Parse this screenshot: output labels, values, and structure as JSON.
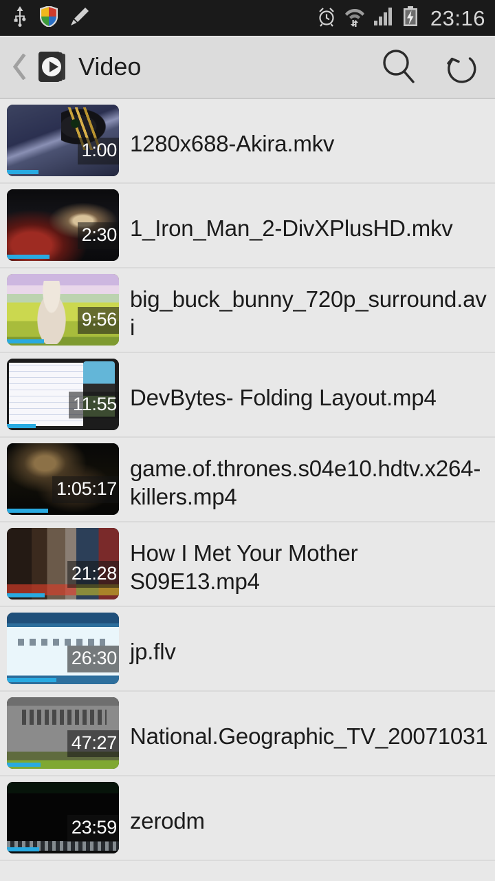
{
  "statusbar": {
    "time": "23:16",
    "left_icons": [
      {
        "name": "usb-icon"
      },
      {
        "name": "security-shield-icon"
      },
      {
        "name": "pencil-edit-icon"
      }
    ],
    "right_icons": [
      {
        "name": "alarm-clock-icon"
      },
      {
        "name": "wifi-transfer-icon"
      },
      {
        "name": "cellular-signal-icon"
      },
      {
        "name": "battery-charging-icon"
      }
    ]
  },
  "actionbar": {
    "back_label": "‹",
    "app_icon_name": "video-app-icon",
    "title": "Video",
    "search_label": "search-icon",
    "refresh_label": "refresh-icon"
  },
  "colors": {
    "accent_progress": "#29aae1",
    "background": "#e8e8e8",
    "actionbar_bg": "#dcdcdc",
    "statusbar_bg": "#1a1a1a",
    "divider": "#dadada",
    "title_text": "#1b1b1b"
  },
  "list": {
    "items": [
      {
        "title": "1280x688-Akira.mkv",
        "duration": "1:00",
        "progress_percent": 28,
        "art": "art-akira"
      },
      {
        "title": "1_Iron_Man_2-DivXPlusHD.mkv",
        "duration": "2:30",
        "progress_percent": 38,
        "art": "art-ironman"
      },
      {
        "title": "big_buck_bunny_720p_surround.avi",
        "duration": "9:56",
        "progress_percent": 33,
        "art": "art-bunny"
      },
      {
        "title": "DevBytes- Folding Layout.mp4",
        "duration": "11:55",
        "progress_percent": 26,
        "art": "art-devbytes"
      },
      {
        "title": "game.of.thrones.s04e10.hdtv.x264-killers.mp4",
        "duration": "1:05:17",
        "progress_percent": 37,
        "art": "art-got"
      },
      {
        "title": "How I Met Your Mother S09E13.mp4",
        "duration": "21:28",
        "progress_percent": 34,
        "art": "art-himym"
      },
      {
        "title": "jp.flv",
        "duration": "26:30",
        "progress_percent": 44,
        "art": "art-jp"
      },
      {
        "title": "National.Geographic_TV_20071031",
        "duration": "47:27",
        "progress_percent": 30,
        "art": "art-natgeo"
      },
      {
        "title": "zerodm",
        "duration": "23:59",
        "progress_percent": 29,
        "art": "art-zerodm"
      }
    ]
  }
}
